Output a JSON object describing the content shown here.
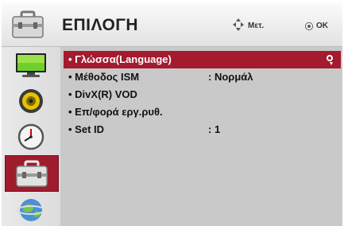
{
  "header": {
    "title": "ΕΠΙΛΟΓΗ",
    "move_hint": "Μετ.",
    "ok_hint": "OK",
    "icon": "toolbox-icon"
  },
  "sidebar": {
    "items": [
      {
        "name": "picture-icon",
        "active": false
      },
      {
        "name": "audio-icon",
        "active": false
      },
      {
        "name": "clock-icon",
        "active": false
      },
      {
        "name": "toolbox-icon",
        "active": true
      },
      {
        "name": "network-globe-icon",
        "active": false
      }
    ]
  },
  "menu": {
    "items": [
      {
        "label": "• Γλώσσα(Language)",
        "value": "",
        "selected": true
      },
      {
        "label": "• Μέθοδος ISM",
        "value": ": Νορμάλ",
        "selected": false
      },
      {
        "label": "• DivX(R) VOD",
        "value": "",
        "selected": false
      },
      {
        "label": "• Επ/φορά εργ.ρυθ.",
        "value": "",
        "selected": false
      },
      {
        "label": "• Set ID",
        "value": ": 1",
        "selected": false
      }
    ]
  },
  "colors": {
    "accent": "#a41a2f",
    "panel": "#c9c9c9"
  }
}
